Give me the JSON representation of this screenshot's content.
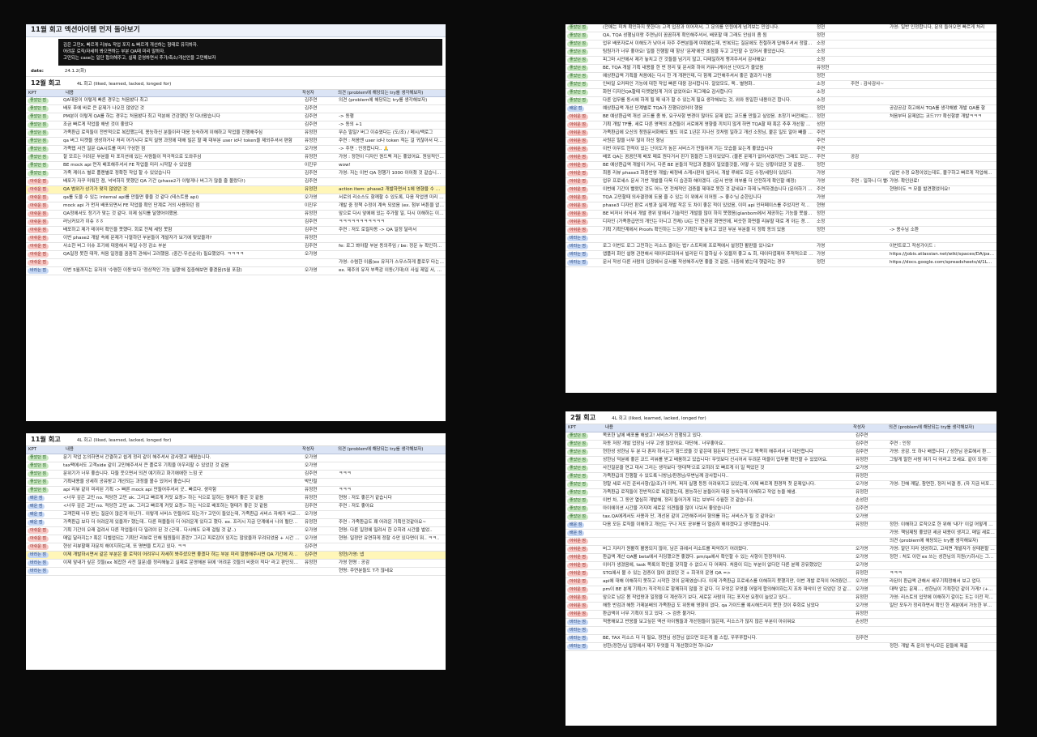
{
  "screens": {
    "s1": {
      "title": "11월 회고 액션아이템 먼저 돌아보기",
      "black_lines": [
        "김은 고민X, 빠르게 리뷰& 작업 포지 & 빠르게 개선하는 형태로 유지하자.",
        "어려운 로직/자세히 봐으면하는 부분 QA때 미리 말하자.",
        "고민되는 case는 일단 협의해주고, 실제 운영하면서 추가/축소/개선안을 고민해보자"
      ],
      "date_label": "date:",
      "date_value": "24.1.2(화)",
      "section": "12월 회고",
      "section_sub": "4L 회고 (liked, learned, lacked, longed for)",
      "columns": {
        "kpt": "KPT",
        "content": "내용",
        "author": "작성자",
        "opinion": "의견 (problem에 해당되는 try를 생각해보자)"
      },
      "rows": [
        {
          "k": "좋았던 점",
          "kc": "g",
          "c": "QA대응이 이렇게 빠른 경우는 처음봤다 최고",
          "a": "김주연",
          "o": "의견 (problem에 해당되는 try를 생각해보자)"
        },
        {
          "k": "좋았던 점",
          "kc": "g",
          "c": "배포 후에 바로 큰 문제가 나오진 않았던 것",
          "a": "김주연",
          "o": ""
        },
        {
          "k": "좋았던 점",
          "kc": "g",
          "c": "PM분이 이렇게 QA를 하는 경우는 처음봤다 최고 덕분에 건강했던 첫 다녀왔습니다",
          "a": "김주연",
          "o": "-> 동행"
        },
        {
          "k": "좋았던 점",
          "kc": "g",
          "c": "조금 빠르게 작업을 해낸 것이 좋았다",
          "a": "김주연",
          "o": "-> 동의 +1"
        },
        {
          "k": "좋았던 점",
          "kc": "g",
          "c": "가족환급 로직들이 전반적으로 복잡했는데, 용능하신 분들이라 대응 능숙하게 이해하고 작업을 진행해주심",
          "a": "유정현",
          "o": "무슨 말일? 버그 이슈였다는 (도/조) / 메시/백로그"
        },
        {
          "k": "좋았던 점",
          "kc": "g",
          "c": "qa 버그 티켓을 생성하거나 처리 어가시다 로직 설명 과정에 대해 빌은 할 때 대부분 user id나 token을 제외주셔서 편함",
          "a": "유정현",
          "o": "주연 : 처음엔 user id나 token 적는 걸 귀찮아서 다른 분들이 적어주시는 걸 보고"
        },
        {
          "k": "좋았던 점",
          "kc": "g",
          "c": "가족탭 사전 질문 QA시트를 미리 구성한 점",
          "a": "오가영",
          "o": "-> 주연 : 인정합니다.. 🙏"
        },
        {
          "k": "좋았던 점",
          "kc": "g",
          "c": "잘 모르는 어려운 부분을 타 포지션에 있는 사람들이 적극적으로 도와주심",
          "a": "유정현",
          "o": "가영 : 정현이 디자인 퀀드백 저는 좋았어요. 원임적인 일정을 고려해서 의도벽해서 좋았어요"
        },
        {
          "k": "좋았던 점",
          "kc": "g",
          "c": "BE mock api 먼저 배포해주셔서 FE 작업을 미리 시작할 수 있었음",
          "a": "이진우",
          "o": "wow!"
        },
        {
          "k": "좋았던 점",
          "kc": "g",
          "c": "가족 케이스 별로 플랜별로 정확한 작업 할 수 있었습니다",
          "a": "김주연",
          "o": "가영: 저는 이번 QA 정행가 1000 이어졌 것 같습니다, 제가 '생각한 것' 보단"
        },
        {
          "k": "아쉬운 점",
          "kc": "r",
          "c": "배포가 자꾸 미뤄진 점, 넉넉하지 못했던 QA 기간 (phase2가 이렇게나 버그가 많을 줄 몰랐다!)",
          "a": "김주연",
          "o": ""
        },
        {
          "k": "아쉬운 점",
          "kc": "r",
          "c": "QA 범위가 상기가 맞지 않았던 것",
          "a": "유정현",
          "o": "action item: phase2 개발하면서 1에 영향을 수 밖에 없다",
          "hl": true
        },
        {
          "k": "아쉬운 점",
          "kc": "r",
          "c": "qa를 도울 수 있는 internal api를 만들면 좋을 것 같다 (테스트용 api)",
          "a": "오가영",
          "o": "서로의 리소스도 함께할 수 있도록, 다음 작업엔 미리 api를 만들어봐야겠음"
        },
        {
          "k": "아쉬운 점",
          "kc": "r",
          "c": "mock api 가 먼저 배포되면서 FE 작업을 확인 단계로 거의 사용하던 점",
          "a": "이진우",
          "o": "개발 중 정책 수정이 계속 되었음 (ex. 첨부 버튼을 없음) -> 로직 변경 -> 사이즈"
        },
        {
          "k": "아쉬운 점",
          "kc": "r",
          "c": "QA정에서도 정기가 맞는 것 같다. 이제 심지를 달했어야했음.",
          "a": "유정현",
          "o": "앞으로 다시 앞에에 있는 주가할 일, 다시 이해하는 이도(?)가 다릅 (before/qa/pd)"
        },
        {
          "k": "아쉬운 점",
          "kc": "r",
          "c": "러닝커브가 이슈 ㅎㅎ",
          "a": "김주연",
          "o": "ㅋㅋㅋㅋㅋㅋㅋㅋㅋㅋㅋ"
        },
        {
          "k": "아쉬운 점",
          "kc": "r",
          "c": "배포하고 제가 테이터 확인을 못했다. 회로 전체 세팅 못함",
          "a": "김주연",
          "o": "주연 : 저도 로컬자동 -> QA 일정 달라서"
        },
        {
          "k": "아쉬운 점",
          "kc": "r",
          "c": "이번 phase2 개발 속에 문제가 나열하던 부분들이 개발자가 보기에 맞았을까?",
          "a": "유정현",
          "o": ""
        },
        {
          "k": "아쉬운 점",
          "kc": "r",
          "c": "사소한 버그 이슈 조기에 대응해서 파일 수정 감소 부분",
          "a": "김주연",
          "o": "fe: 로그 봐야할 부분 동의추임 / be: 정운 뉴 확인하고 느끼해주임"
        },
        {
          "k": "아쉬운 점",
          "kc": "r",
          "c": "QA일정 못한 대작, 처음 일정을 꼼꼼히 관해서 고려했음. (중간-우선순위) 필요했었다. ㅋㅋㅋㅋ",
          "a": "오가영",
          "o": ""
        },
        {
          "k": "아쉬운 점",
          "kc": "r",
          "c": "",
          "a": "",
          "o": "가영: 수렴한 이름(ex 유저가 스무스하게 플로우 타는것) = 정상적인 기능(두개에도"
        },
        {
          "k": "바라는 점",
          "kc": "b",
          "c": "이번 5월까지는 유저의 '수렴한 이동'보다 '정상적인 기능 실행'에 집중해보면 좋겠음(5월 포함)",
          "a": "오가영",
          "o": "ex. 제주의 유저 부족감 이동(기대)이 사실 제일 서, 다음 업데 가능"
        }
      ]
    },
    "s2": {
      "section": "11월 회고",
      "section_sub": "4L 회고 (liked, learned, lacked, longed for)",
      "columns": {
        "kpt": "KPT",
        "content": "내용",
        "author": "작성자",
        "opinion": "의견 (problem에 해당되는 try를 생각해보자)"
      },
      "rows": [
        {
          "k": "좋았던 점",
          "kc": "g",
          "c": "문기 작업 논의하면서 간결하고 쉽게 정리 같이 해주셔서 감사했고 배웠습니다.",
          "a": "오가영",
          "o": ""
        },
        {
          "k": "좋았던 점",
          "kc": "g",
          "c": "tax팩에서도 고객side 같이 고민해주셔서 큰 플로우 기획을 아우리할 수 있었던 것 같음",
          "a": "오가영",
          "o": ""
        },
        {
          "k": "좋았던 점",
          "kc": "g",
          "c": "문위기가 너무 좋습니다. 다들 웃으면서 의견 얘기하고 화기애애한 느낌 굿",
          "a": "김주연",
          "o": "ㅋㅋㅋ"
        },
        {
          "k": "좋았던 점",
          "kc": "g",
          "c": "기획내용을 상세히 공유받고 개선되는 과정을 볼수 있어서 좋습니다",
          "a": "박민철",
          "o": ""
        },
        {
          "k": "좋았던 점",
          "kc": "g",
          "c": "api 리뷰 같이 미리된 기획 -> 빠른 mock api 만들어주셔서 굿.. 빠르다. 생각함",
          "a": "유정현",
          "o": "ㅋㅋㅋ"
        },
        {
          "k": "배운 점",
          "kc": "b",
          "c": "<너무 깊은 고민 no. 적당한 고민 ok. 그리고 빠르게 커밋 요청> 하는 식으로 일하는 형태가 좋은 것 같음",
          "a": "유정현",
          "o": "현명 : 저도 좋은거 같습니다"
        },
        {
          "k": "배운 점",
          "kc": "b",
          "c": "<너무 깊은 고민 no. 적당한 고민 ok. 그리고 빠르게 커밋 요청> 하는 식으로 배포하는 형태가 좋은 것 같음",
          "a": "김주연",
          "o": "주연 : 저도 좋아요"
        },
        {
          "k": "배운 점",
          "kc": "b",
          "c": "고객한테 너무 받는 질문이 많은게 아닌가.. 이렇게 서비스 만들어도 되는가? 고민이 들었는데, 가족환급 서비스 자체가 비교할 서비스가 없기때문에 가치만 있다고",
          "a": "오가영",
          "o": ""
        },
        {
          "k": "배운 점",
          "kc": "b",
          "c": "가족환급 보다 더 어려운게 있을까? 했는데.. 다른 퍼블들이 더 어려운게 있다고 했다. ex. 프리시 지금 단계에서 나의 혈단지와 기획하기 생각하고.. 해야겠다",
          "a": "유정현",
          "o": "주연 : 가족환급도 꽤 어려운 기획인것같아요~"
        },
        {
          "k": "아쉬운 점",
          "kc": "r",
          "c": "기획 기간이 오래 걸려서 다른 작업들이 다 밀려야 된 것 (근데.. 다시해도 오래 걸릴 것 같..)",
          "a": "오가영",
          "o": "현명: 다른 일정에 밀려서 한 오히려 시간을 벌었.."
        },
        {
          "k": "아쉬운 점",
          "kc": "r",
          "c": "매일 달라지는? 혹은 디벨업되는 기획안 리뷰로 인해 팀원들이 혼란? 그리고 피로감이 있지는 않았을까 우려되었음 + 시간 압박",
          "a": "오가영",
          "o": "현명: 일정만 유연하게 정할 수만 있다면이 뭐.. ㅋㅋ.."
        },
        {
          "k": "아쉬운 점",
          "kc": "r",
          "c": "현상 리뷰할때 자문치 해야지하는데, 또 명변을 트지고 있다. ㅋㅋ",
          "a": "김주연",
          "o": ""
        },
        {
          "k": "바라는 점",
          "kc": "b",
          "c": "이제 개발하시면서 같은 부분은 줄 로직이 어려우니 자세히 봐주셨으면 좋겠다 하는 부분 미리 말씀해주시면 QA 기간에 자세하게 볼 수 있어서 좋습니다!",
          "a": "김주연",
          "o": "정현/가영: 넵",
          "hl": true
        },
        {
          "k": "바라는 점",
          "kc": "b",
          "c": "이제 앞내가 싶은 것들(ex 복잡한 사전 질문)을 정리해놓고 실제로 운영해본 뒤에 '어려운 것들의 비중이 적다' 라고 판단되면 그것들을 없애가나 축소하면 좋을 듯!",
          "a": "유정현",
          "o": "가영 현명 : 공감"
        },
        {
          "k": "바라는 점",
          "kc": "b",
          "c": "",
          "a": "",
          "o": "현명: 주연분들도 T가 많네요"
        }
      ]
    },
    "s3": {
      "rows": [
        {
          "k": "좋았던 점",
          "kc": "g",
          "c": "(전에는 미처 확인하지 못한다) 고객 입장과 이어져서, 그 문의를 인원에게 넘겨보는 민입니다.",
          "a": "정현",
          "t": "",
          "o": "가영: 일반 인정합니다, 문의 들어오면 빠르게 처리"
        },
        {
          "k": "좋았던 점",
          "kc": "g",
          "c": "QA, TQA  성행님이랑 주연님이 꼼꼼하게 확인해주셔서, 배포할 때 그래도 안심이 좀 됨",
          "a": "정현",
          "t": "",
          "o": ""
        },
        {
          "k": "좋았던 점",
          "kc": "g",
          "c": "업무 배포자로서 이해도가 낮아서 자주 주변분들께 여쭤봤는데, 반복되는 질문에도 친절하게 답해주셔서 정말 감사했습니다.",
          "a": "소정",
          "t": "",
          "o": ""
        },
        {
          "k": "좋았던 점",
          "kc": "g",
          "c": "팀원가가 너무 좋아요! 일을 진행할 때 항상 '문제'에만 초점을 두고 고민할 수 있어서 좋았습니다.",
          "a": "소정",
          "t": "",
          "o": ""
        },
        {
          "k": "좋았던 점",
          "kc": "g",
          "c": "피그마 시안에서 제가 놓치고 간 것들을 넘기지 않고, 디테일하게 챙겨주셔서 감사해요!",
          "a": "소정",
          "t": "",
          "o": ""
        },
        {
          "k": "좋았던 점",
          "kc": "g",
          "c": "BE, TQA  개발 기획 내용을 한 번 정리 및 문서화 하여 커뮤니케이션 난이도가 줄었음",
          "a": "유정현",
          "t": "",
          "o": ""
        },
        {
          "k": "좋았던 점",
          "kc": "g",
          "c": "예상환급액 기획을 처음에는 다시 한 개 개편인데, 다 함께 고민해주셔서 좋은 결과가 나옴",
          "a": "정현",
          "t": "",
          "o": ""
        },
        {
          "k": "좋았던 점",
          "kc": "g",
          "c": "인바일 오커파인 기능에 대한 작업 빠른 대응 감사합니다. 알았모도, 쭉.. 별명화..",
          "a": "소정",
          "t": "주연 : 감사감사~",
          "o": ""
        },
        {
          "k": "좋았던 점",
          "kc": "g",
          "c": "화면 디자인QA할때 티켓열링게 거의 없었어요! 피그매요 감사합니다",
          "a": "소정",
          "t": "",
          "o": ""
        },
        {
          "k": "좋았던 점",
          "kc": "g",
          "c": "다른 업무를 동시에 하게 될 때 내가 할 수 있는게 필요 생각해보는 것, 위와 동일한 내용이긴 합니다.",
          "a": "소정",
          "t": "",
          "o": ""
        },
        {
          "k": "배운 점",
          "kc": "b",
          "c": "예상환급액 개선 단계별로 TQA가 진행되었어야 했음",
          "a": "정현",
          "t": "",
          "o": "공감공감 회고에서 TQA를 생각해봤 개발 QA를 함"
        },
        {
          "k": "아쉬운 점",
          "kc": "r",
          "c": "BE  예상환급액 개선 코드를 좀 봐, 요구사항 변경이 많아도 문제 없는 코드를 만들고 싶었음. 초창기 버전에는 그것이 좀 어려웠습니다..",
          "a": "정현",
          "t": "",
          "o": "처음부터 문제없는 코드??? 확신함뿐 개발ㅋㅋㅋ"
        },
        {
          "k": "아쉬운 점",
          "kc": "r",
          "c": "기획  개발 TF를, 세로 다른 영역의 초견들이 서로에게 영향을 끼치지 않게 하면 TQA할 때 혹은 추후 개선할 때 공청하기 쉬웠었겠다",
          "a": "성현",
          "t": "",
          "o": ""
        },
        {
          "k": "아쉬운 점",
          "kc": "r",
          "c": "가족환급에 오신의 청원문서화해도 별도 이로 1년은 지나신 것처럼 일하고 개선 소청님, 붙은 일도 알아 빼줄 정인 것 같습니다~",
          "a": "주연",
          "t": "",
          "o": ""
        },
        {
          "k": "아쉬운 점",
          "kc": "r",
          "c": "사원은 말을 너무 많이 하신 형님",
          "a": "주연",
          "t": "",
          "o": ""
        },
        {
          "k": "아쉬운 점",
          "kc": "r",
          "c": "이번 아우트 한적이 있는 난이도가 높은 서비스가 만들어져 기는 모습을 보는게 좋았습니다",
          "a": "주연",
          "t": "",
          "o": ""
        },
        {
          "k": "아쉬운 점",
          "kc": "r",
          "c": "배포  QA는 꼼꼼단계 배포 때로 원다거서 왼가 힘들한 느낌이있었다. (물론 문제가 없어서였지만) 그래도 모든안 배포 를 수 있을까요?",
          "a": "주연",
          "t": "공감",
          "o": ""
        },
        {
          "k": "아쉬운 점",
          "kc": "r",
          "c": "BE  예상환급액 개발이 커서, 다른 BE 분들의 작업과 충돌이 일었을것을, 어떻 수 있는 상황이었던 것 같음..",
          "a": "정현",
          "t": "",
          "o": ""
        },
        {
          "k": "아쉬운 점",
          "kc": "r",
          "c": "최종 리뷰 phase3 화종반영 개발/ 배정배 스케시판이 빌리서, 개발 루에도 모든 수정/세팅이 있었다.",
          "a": "가영",
          "t": "",
          "o": "(일반 수정 요청이었는데도, 불구하고 빠르게 작업해주셔서 감사합니다 진짜 남)"
        },
        {
          "k": "아쉬운 점",
          "kc": "r",
          "c": "업무 프로세스  문서 기반 개발을 더욱 더 습관화 해야겠다. (문서 반영 여부를 더 안전하게 확인할 예정)",
          "a": "가영",
          "t": "주연 : 일하니 더 빨라졌습니다요..",
          "o": "가영: 확인완료!"
        },
        {
          "k": "아쉬운 점",
          "kc": "r",
          "c": "이번에 기간이 빨랐던 것도 어느 먼 전체적인 검증을 제대로 못한 것 같네요? 하제 노력하겠습니다 (문어하기 비전, 초주)",
          "a": "주연",
          "t": "",
          "o": "현명이도 ㅋ 모을 발견했었어요!"
        },
        {
          "k": "아쉬운 점",
          "kc": "r",
          "c": "TQA 고민할때 의사결정에 도움 줄 수 있는 이 위에서 이어원 -> 좋수'님 순한입니다",
          "a": "가영",
          "t": "",
          "o": ""
        },
        {
          "k": "아쉬운 점",
          "kc": "r",
          "c": "phase3 디자인 판로 시범과 실제 개발 작은 도 차이 좋은 적이 있었음, 이미 api 인터페이스를 주었지만 작업 시작하고 있는 디자인생 api 수정 요청이 발생했음, 빠르게 api 수정 요청을 반영하게 했었음",
          "a": "현명",
          "t": "",
          "o": ""
        },
        {
          "k": "아쉬운 점",
          "kc": "r",
          "c": "BE  비저너 어닉서 개발 경위 앞에서 기술적인 개발을 많이 하지 못했음(glanbom에서 제공하는 기능을 못쓸어가나,",
          "a": "정현",
          "t": "",
          "o": ""
        },
        {
          "k": "아쉬운 점",
          "kc": "r",
          "c": "디자인  (가족환급만의 개인는 아니고 전체) UI는 단 연관된 화면안에, 비슷한 화면을 리뷰할 대로 게 아는 경우가 있어 더 정확하게 새로운 유",
          "a": "소정",
          "t": "",
          "o": ""
        },
        {
          "k": "아쉬운 점",
          "kc": "r",
          "c": "기획  기획단계에서 Proofs 확인하는 느낌? 기획한 때 놓치고 있던 부분 부분을 더 정확 동의 있음",
          "a": "정현",
          "t": "",
          "o": "-> 용수님 소환"
        },
        {
          "k": "바라는 점",
          "kc": "b",
          "c": "",
          "a": "",
          "t": "",
          "o": ""
        },
        {
          "k": "바라는 점",
          "kc": "b",
          "c": "로그  이번도 로그 고민하는 리소스 줄이는 법? 스트피에 프로젝에서 설정한 활판을 있나요?",
          "a": "가영",
          "t": "",
          "o": "이번트로그 작성가이드 :"
        },
        {
          "k": "바라는 점",
          "kc": "b",
          "c": "앱플리 화인 설명 관련해서 테이터로되어서 빌리된 더 잘하실 수 있을까 좋고 & 회, 테이터엽제어 추적적으로 세팅 해주실 수 있을까요? (제가 예도 보완했어도 전문가 분이 계시기에)",
          "a": "가영",
          "t": "",
          "o": "https://jobis.atlassian.net/wiki/spaces/DA/pages/960141149"
        },
        {
          "k": "바라는 점",
          "kc": "b",
          "c": "문서 작성  다른 사람의 입장에서 문서를 작성해주시면 좋을 것 같음, 나중에 봤는데 헷갈리는 경우",
          "a": "정현",
          "t": "",
          "o": "https://docs.google.com/spreadsheets/d/1L6C9SaIEVbmJDqFzhIv5vGlI"
        }
      ]
    },
    "s4": {
      "section": "2월 회고",
      "section_sub": "4L 회고 (liked, learned, lacked, longed for)",
      "columns": {
        "kpt": "KPT",
        "content": "내용",
        "author": "작성자",
        "opinion": "의견 (problem에 해당되는 try를 생각해보자)"
      },
      "rows": [
        {
          "k": "좋았던 점",
          "kc": "g",
          "c": "목포한 날에 배포를 해냈고! 서비스가 진행되고 있다.",
          "a": "김주연",
          "o": ""
        },
        {
          "k": "좋았던 점",
          "kc": "g",
          "c": "자동 저장 개발 업장님 너무 고생 많았어요. 대단해.. 너무좋아요..",
          "a": "김주연",
          "o": "주연 : 인정"
        },
        {
          "k": "좋았던 점",
          "kc": "g",
          "c": "현한성 성한님 두 분 다 혼자 하시는거 힘드셨을 것 같은데 힘든티 한번도 안나고 목목히 해주셔서 너 대단합니다",
          "a": "김주연",
          "o": "가영: 공감. 또 하나 배웁니다. / 성한님 완료해서 환급액 계산해야했는 건 업마요"
        },
        {
          "k": "좋았던 점",
          "kc": "g",
          "c": "성한님 덕분에 좋은 코드 리뷰를 받고 배움하고 있습니다! 무엇보다 신시어서 두려운 마을이 업무를 확인할 수 있었어요.",
          "a": "유정현",
          "o": "그렇게 말한 사람 여기 다 어리고 모세요. 같이 되게!"
        },
        {
          "k": "좋았던 점",
          "kc": "g",
          "c": "사진질문을 연고 대서 그리는 생각보다 '양대책'으로 오히려 모 빠르게 이 일 찍었던 것",
          "a": "오가영",
          "o": ""
        },
        {
          "k": "좋았던 점",
          "kc": "g",
          "c": "가족환급의 진행할 수 있도록 니방님/환경님/무변님께 감사합니다..",
          "a": "유정현",
          "o": ""
        },
        {
          "k": "좋았던 점",
          "kc": "g",
          "c": "정말 세로 사진 준비사항(일/조)가 이럭, 퍼저 실행 등등 어려워지고 있었는데, 어제 빠르게 환경적 첫 문제입니다.",
          "a": "오가영",
          "o": "가영: 진해 깨달, 참면한, 정리 비결 증, (자 지금 비포고 정리를 한 우로 있어요 ㅋ..)"
        },
        {
          "k": "좋았던 점",
          "kc": "g",
          "c": "가족환급 로직들이 전반적으로 복잡했는데, 용능하신 분들이라 대응 능숙하게 이해하고 작업 능을 해냄.",
          "a": "유정현",
          "o": ""
        },
        {
          "k": "좋았던 점",
          "kc": "g",
          "c": "이번 차, 그 동안 열심히 개발해, 정리 들어가게 되는 보부터 수월한 것 같습니다.",
          "a": "손성현",
          "o": ""
        },
        {
          "k": "좋았던 점",
          "kc": "g",
          "c": "아이에이션 시간을 가지며 새로운 의견들을 많이 나눠서 좋았습니다!",
          "a": "김주연",
          "o": ""
        },
        {
          "k": "좋았던 점",
          "kc": "g",
          "c": "tax.QA에게서도 사용자 단, 개선된 같이 고민해주셔서 향의를 하는 서비스가 될 것 같아요!",
          "a": "오가영",
          "o": ""
        },
        {
          "k": "배운 점",
          "kc": "b",
          "c": "다음 모든 로직을 이해하고 개선는 구나 저도 공부를 더 열심히 해야겠다고 생각했습니다.",
          "a": "유정현",
          "o": "정현: 이해하고 로직으로 한 위해 '내가' 이걸 어떻게 했지..?'라는 생각이 들던"
        },
        {
          "k": "배운 점",
          "kc": "b",
          "c": "",
          "a": "",
          "o": "가영: 책임제팅 좋았던 세금 내용이 생겨고, 매일 새로운 지식 학습하는 것 같은 느낌"
        },
        {
          "k": "아쉬운 점",
          "kc": "r",
          "c": "",
          "a": "",
          "o": "의견 (problem에 해당되는 try를 생각해보자)"
        },
        {
          "k": "아쉬운 점",
          "kc": "r",
          "c": "버그 지라가 원활히 활용되지 않아, 남은 큐에서 리소트를 파악하기 어려웠다.",
          "a": "오가영",
          "o": "가영: 알던 지라 생성하고, 고치면 개발자가 상태판할 (성세 논이는 쓰레드에서)"
        },
        {
          "k": "아쉬운 점",
          "kc": "r",
          "c": "환급액 계산 QA를 beta에서 리딩했으면 좋겠다. pm/qa에서 확인할 수 있는 사항이 한정적이다.",
          "a": "오가영",
          "o": "정현 : 처도 이런 ex 쓰는 성한님의 지원(?)하시는 그림이 나었을것같다는 생각이 드네요"
        },
        {
          "k": "아쉬운 점",
          "kc": "r",
          "c": "이어가 생겼음에, task 목록의 확인을 갖지할 수 없으시 다 어쩌다. 처음이 되는 부분이 없다던 다른 분께 공유했었던",
          "a": "오가영",
          "o": ""
        },
        {
          "k": "아쉬운 점",
          "kc": "r",
          "c": "STG에서 볼 수 있는 검증이 많이 없었던 것 + 회귀의 운영 QA =>",
          "a": "유정현",
          "o": "ㅋㅋㅋ"
        },
        {
          "k": "아쉬운 점",
          "kc": "r",
          "c": "api에 대해 이해하지 못하고 시작한 것이 문제였습니다. 이제 가족환급 프로세스를 이해하지 못했지만, 이번 개발 로직이 어려웠던 것 같다고 판단 생각이 되었다.",
          "a": "오가영",
          "o": "라된이 환급액 관해서 세우기획정해서 보고 업다."
        },
        {
          "k": "아쉬운 점",
          "kc": "r",
          "c": "pm이 BE 분께 기획(?) 직각적으로 함께하지 않을 것 같다. 더 무엇은 무엇을 어떻게 합의해야하는지 조차 파악이 안 되었던 것 같습니다 차다로 감",
          "a": "오가영",
          "o": "대략 없는 문제..., 성한님이 기획한던 같이 가게?  (+지파) 사진 질문엔 기획 리뷰"
        },
        {
          "k": "아쉬운 점",
          "kc": "r",
          "c": "앞으로 남은 봄 작업량과 일정을 더 계산하기 보다, 세로운 사람이 하는 포지션 요청이 늘었고 있다...",
          "a": "유정현",
          "o": "가영: 리스토의 입맛에 이해하기 갈이는 도는 이전 작업 할당하지, 내일 6시 회의"
        },
        {
          "k": "아쉬운 점",
          "kc": "r",
          "c": "해등 반검과 해등 가제분배의 가족환급 도 위동해 영향이 없다, qa 가이드를 얘시해드리지 못한 것이 후회로 남았다",
          "a": "오가영",
          "o": "일단 모두가 정리하면서 확인 한 세분에서 가능한 부분만 우선 정정하고 1467?로 -> 예상 환급액 리뷰"
        },
        {
          "k": "아쉬운 점",
          "kc": "r",
          "c": "환급액이 너무 기획이 되고 있다. -> 검증 불가다.",
          "a": "유정현",
          "o": ""
        },
        {
          "k": "바라는 점",
          "kc": "b",
          "c": "적용해보고 반응을 보고싶은 액션 아이템들과 개선점들이 많은데, 리소스가 많지 않은 부분이 아쉬워요",
          "a": "손성현",
          "o": ""
        },
        {
          "k": "바라는 점",
          "kc": "b",
          "c": "",
          "a": "",
          "o": ""
        },
        {
          "k": "바라는 점",
          "kc": "b",
          "c": "BE, TAX 리소스 더 더 필요, 정현님 성한님 없으면 모든게 올 스탑, 우쭈쭈합니다.",
          "a": "김주연",
          "o": ""
        },
        {
          "k": "바라는 점",
          "kc": "b",
          "c": "성한(정현)님 입장에서 제가 무엇을 더 개선했으면 하나요?",
          "a": "",
          "o": "정현: 개발 측 문의 방식/모든 문들에 제출"
        }
      ]
    }
  }
}
